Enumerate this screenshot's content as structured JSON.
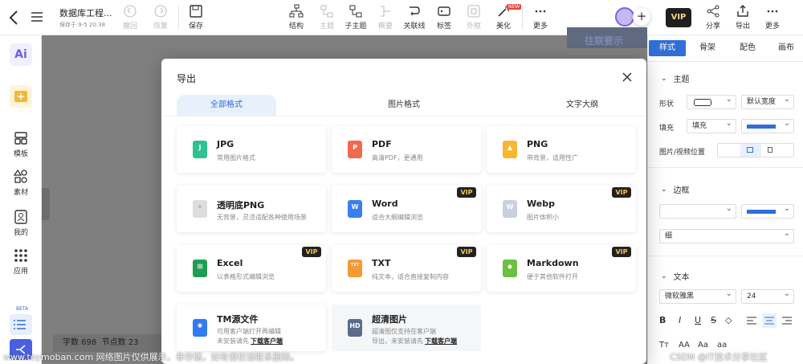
{
  "topbar": {
    "doc_title": "数据库工程...",
    "save_status": "保存于 9-5 20:38",
    "undo": "撤回",
    "redo": "恢复",
    "save": "保存",
    "tools": [
      "结构",
      "主题",
      "子主题",
      "概要",
      "关联线",
      "标签",
      "外框",
      "美化",
      "更多"
    ],
    "new_badge": "NEW",
    "vip": "VIP",
    "right_tools": [
      "分享",
      "导出",
      "更多"
    ]
  },
  "leftrail": {
    "items": [
      "模板",
      "素材",
      "我的",
      "应用"
    ],
    "beta": "BETA"
  },
  "canvas": {
    "node_text": "往联要示",
    "stats": {
      "words": "字数 698",
      "nodes": "节点数 23"
    }
  },
  "rightpanel": {
    "tabs": [
      "样式",
      "骨架",
      "配色",
      "画布"
    ],
    "theme_title": "主题",
    "shape_label": "形状",
    "shape_value2": "默认宽度",
    "fill_label": "填充",
    "fill_value": "填充",
    "img_pos_label": "图片/视频位置",
    "border_title": "边框",
    "border_width": "细",
    "text_title": "文本",
    "font_family": "微软雅黑",
    "font_size": "24",
    "text_btns": [
      "B",
      "I",
      "U",
      "S",
      "◇"
    ],
    "case_btns": [
      "Tт",
      "AA",
      "Aa",
      "aa"
    ],
    "colors": {
      "accent": "#2f6fd6"
    }
  },
  "dialog": {
    "title": "导出",
    "tabs": [
      "全部格式",
      "图片格式",
      "文字大纲"
    ],
    "cards": [
      {
        "name": "JPG",
        "desc": "常用图片格式",
        "icon": "J",
        "color": "#2ec38e",
        "vip": false
      },
      {
        "name": "PDF",
        "desc": "高清PDF，更通用",
        "icon": "P",
        "color": "#f06a4f",
        "vip": false
      },
      {
        "name": "PNG",
        "desc": "带背景，适用性广",
        "icon": "▲",
        "color": "#f7b731",
        "vip": false
      },
      {
        "name": "透明底PNG",
        "desc": "无背景，灵活适配各种使用场景",
        "icon": "✦",
        "color": "#dddddd",
        "vip": false
      },
      {
        "name": "Word",
        "desc": "适合大纲编辑浏览",
        "icon": "W",
        "color": "#3b7ef0",
        "vip": true
      },
      {
        "name": "Webp",
        "desc": "图片体积小",
        "icon": "W",
        "color": "#c8d0e0",
        "vip": true
      },
      {
        "name": "Excel",
        "desc": "以表格形式编辑浏览",
        "icon": "⊞",
        "color": "#1f9d55",
        "vip": true
      },
      {
        "name": "TXT",
        "desc": "纯文本，适合直接复制内容",
        "icon": "TXT",
        "color": "#f59a34",
        "vip": true
      },
      {
        "name": "Markdown",
        "desc": "便于其他软件打开",
        "icon": "◆",
        "color": "#6cbf3f",
        "vip": true
      },
      {
        "name": "TM源文件",
        "desc": "可用客户端打开再编辑",
        "desc2": "未安装请先",
        "link": "下载客户端",
        "icon": "✱",
        "color": "#2f7bf0",
        "vip": false
      },
      {
        "name": "超清图片",
        "desc": "超清图仅支持在客户端",
        "desc2": "导出，未安装请先",
        "link": "下载客户端",
        "icon": "HD",
        "color": "#5b6b8c",
        "vip": false
      }
    ],
    "vip_label": "VIP"
  },
  "watermark": {
    "left": "www.toymoban.com 网络图片仅供展示，非存储，如有侵权请联系删除。",
    "right": "CSDN @IT技术分享社区"
  }
}
